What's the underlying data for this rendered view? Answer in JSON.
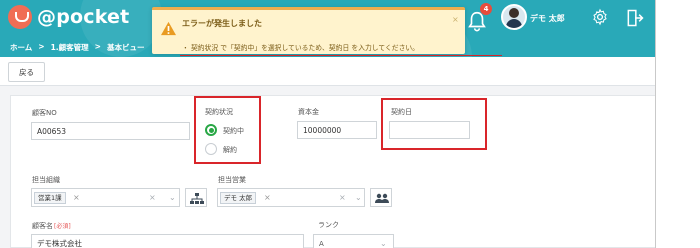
{
  "header": {
    "logo": "@pocket",
    "breadcrumb": [
      "ホーム",
      ">",
      "1.顧客管理",
      ">",
      "基本ビュー"
    ],
    "notification_count": "4",
    "user_name": "デモ 太郎",
    "icons": [
      "bell-icon",
      "gear-icon",
      "logout-icon"
    ]
  },
  "toolbar": {
    "back_label": "戻る"
  },
  "toast": {
    "title": "エラーが発生しました",
    "message": "・ 契約状況 で「契約中」を選択しているため、契約日 を入力してください。",
    "close": "×"
  },
  "form": {
    "customer_no_label": "顧客NO",
    "customer_no_value": "A00653",
    "contract_status_label": "契約状況",
    "contract_status_options": [
      "契約中",
      "解約"
    ],
    "contract_status_selected": "契約中",
    "capital_label": "資本金",
    "capital_value": "10000000",
    "contract_date_label": "契約日",
    "contract_date_value": "",
    "org_label": "担当組織",
    "org_chip": "営業1課",
    "sales_label": "担当営業",
    "sales_chip": "デモ 太郎",
    "customer_name_label": "顧客名",
    "required_label": "[必須]",
    "customer_name_value": "デモ株式会社",
    "rank_label": "ランク",
    "rank_value": "A"
  },
  "colors": {
    "header": "#29a9b8",
    "logo": "#f06d55",
    "error_outline": "#d9252a",
    "toast_background": "#fff3cd",
    "radio_checked": "#28a745"
  }
}
